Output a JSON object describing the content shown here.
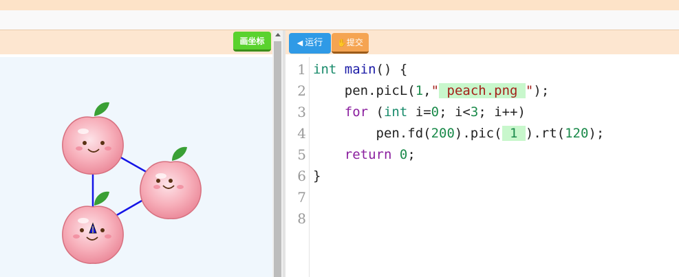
{
  "toolbar": {
    "coords_label": "画坐标",
    "run_label": "运行",
    "run_icon": "play-left-icon",
    "submit_label": "提交",
    "submit_icon": "hand-icon"
  },
  "editor": {
    "line_numbers": [
      "1",
      "2",
      "3",
      "4",
      "5",
      "6",
      "7",
      "8"
    ],
    "lines": [
      [
        {
          "t": "int",
          "c": "kw-type"
        },
        {
          "t": " "
        },
        {
          "t": "main",
          "c": "fn"
        },
        {
          "t": "() {"
        }
      ],
      [
        {
          "t": "    pen.picL("
        },
        {
          "t": "1",
          "c": "num"
        },
        {
          "t": ","
        },
        {
          "t": "\"",
          "c": "str"
        },
        {
          "t": " peach.png ",
          "c": "str hl"
        },
        {
          "t": "\"",
          "c": "str"
        },
        {
          "t": ");"
        }
      ],
      [
        {
          "t": "    "
        },
        {
          "t": "for",
          "c": "kw-ctl"
        },
        {
          "t": " ("
        },
        {
          "t": "int",
          "c": "kw-type"
        },
        {
          "t": " i="
        },
        {
          "t": "0",
          "c": "num"
        },
        {
          "t": "; i<"
        },
        {
          "t": "3",
          "c": "num"
        },
        {
          "t": "; i++)"
        }
      ],
      [
        {
          "t": "        pen.fd("
        },
        {
          "t": "200",
          "c": "num"
        },
        {
          "t": ").pic("
        },
        {
          "t": " 1 ",
          "c": "num hl"
        },
        {
          "t": ").rt("
        },
        {
          "t": "120",
          "c": "num"
        },
        {
          "t": ");"
        }
      ],
      [
        {
          "t": "    "
        },
        {
          "t": "return",
          "c": "kw-ctl"
        },
        {
          "t": " "
        },
        {
          "t": "0",
          "c": "num"
        },
        {
          "t": ";"
        }
      ],
      [
        {
          "t": "}"
        }
      ],
      [],
      []
    ]
  },
  "canvas": {
    "peach_count": 3,
    "line_color": "#1414e6",
    "peach_color": "#f7b0bb",
    "leaf_color": "#3aa035"
  }
}
